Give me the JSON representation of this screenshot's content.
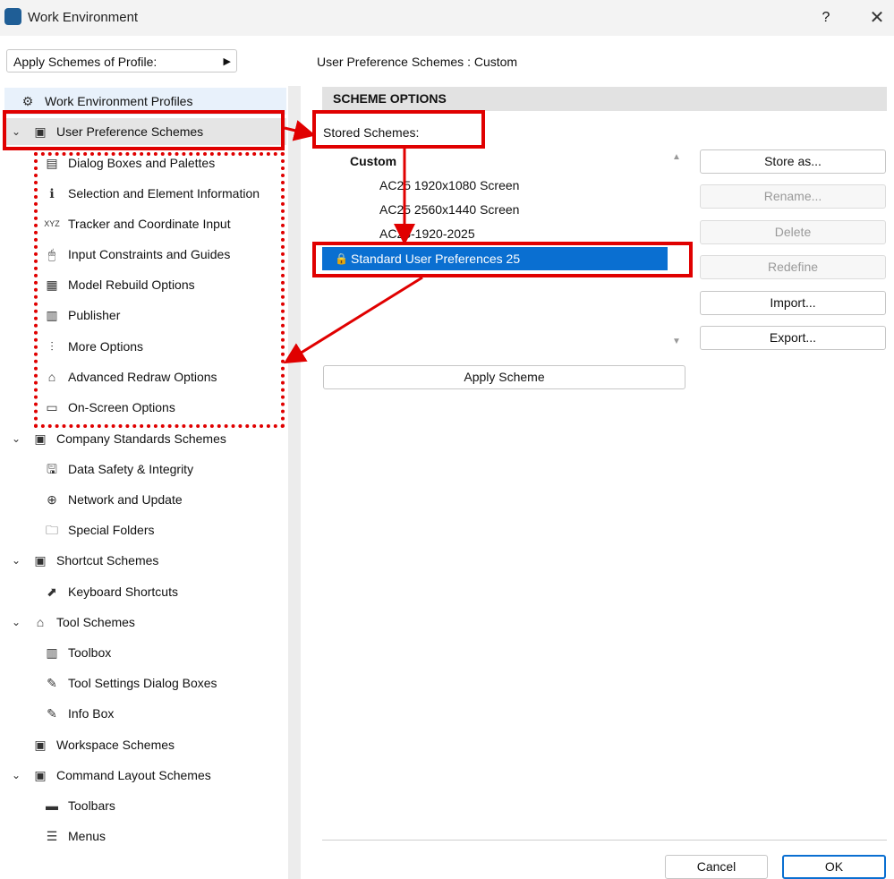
{
  "window": {
    "title": "Work Environment",
    "help": "?",
    "close": "✕"
  },
  "profile_dropdown": {
    "label": "Apply Schemes of Profile:"
  },
  "header": {
    "label": "User Preference Schemes : Custom"
  },
  "tree": {
    "profiles": "Work Environment Profiles",
    "user_pref": "User Preference Schemes",
    "user_pref_children": [
      "Dialog Boxes and Palettes",
      "Selection and Element Information",
      "Tracker and Coordinate Input",
      "Input Constraints and Guides",
      "Model Rebuild Options",
      "Publisher",
      "More Options",
      "Advanced Redraw Options",
      "On-Screen Options"
    ],
    "company": "Company Standards Schemes",
    "company_children": [
      "Data Safety & Integrity",
      "Network and Update",
      "Special Folders"
    ],
    "shortcut": "Shortcut Schemes",
    "shortcut_children": [
      "Keyboard Shortcuts"
    ],
    "tool": "Tool Schemes",
    "tool_children": [
      "Toolbox",
      "Tool Settings Dialog Boxes",
      "Info Box"
    ],
    "workspace": "Workspace Schemes",
    "command": "Command Layout Schemes",
    "command_children": [
      "Toolbars",
      "Menus"
    ]
  },
  "options": {
    "section_title": "SCHEME OPTIONS",
    "stored_label": "Stored Schemes:",
    "group_label": "Custom",
    "schemes": [
      "AC25 1920x1080 Screen",
      "AC25 2560x1440 Screen",
      "AC25-1920-2025"
    ],
    "selected_scheme": "Standard User Preferences 25",
    "apply_button": "Apply Scheme"
  },
  "buttons": {
    "store_as": "Store as...",
    "rename": "Rename...",
    "delete": "Delete",
    "redefine": "Redefine",
    "import": "Import...",
    "export": "Export...",
    "cancel": "Cancel",
    "ok": "OK"
  },
  "colors": {
    "highlight": "#e00000",
    "selection": "#0a6fd1"
  }
}
